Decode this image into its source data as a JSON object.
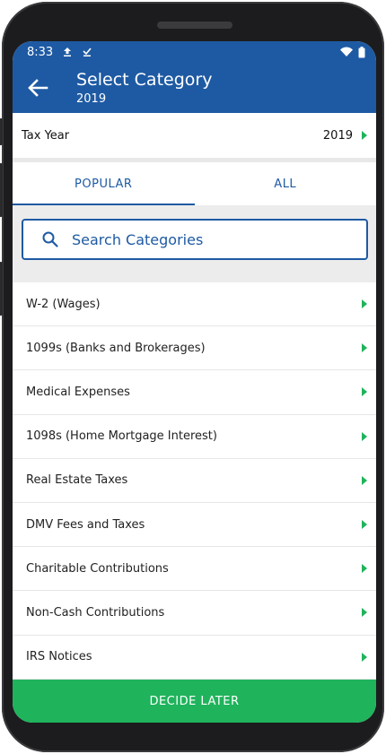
{
  "status_bar": {
    "time": "8:33"
  },
  "app_bar": {
    "title": "Select Category",
    "subtitle": "2019"
  },
  "tax_year": {
    "label": "Tax Year",
    "value": "2019"
  },
  "tabs": [
    {
      "label": "POPULAR"
    },
    {
      "label": "ALL"
    }
  ],
  "search": {
    "placeholder": "Search Categories"
  },
  "categories": [
    {
      "label": "W-2 (Wages)"
    },
    {
      "label": "1099s (Banks and Brokerages)"
    },
    {
      "label": "Medical Expenses"
    },
    {
      "label": "1098s (Home Mortgage Interest)"
    },
    {
      "label": "Real Estate Taxes"
    },
    {
      "label": "DMV Fees and Taxes"
    },
    {
      "label": "Charitable Contributions"
    },
    {
      "label": "Non-Cash Contributions"
    },
    {
      "label": "IRS Notices"
    }
  ],
  "footer": {
    "decide_label": "DECIDE LATER"
  },
  "colors": {
    "primary": "#1e5aa3",
    "accent": "#1fb35c"
  }
}
